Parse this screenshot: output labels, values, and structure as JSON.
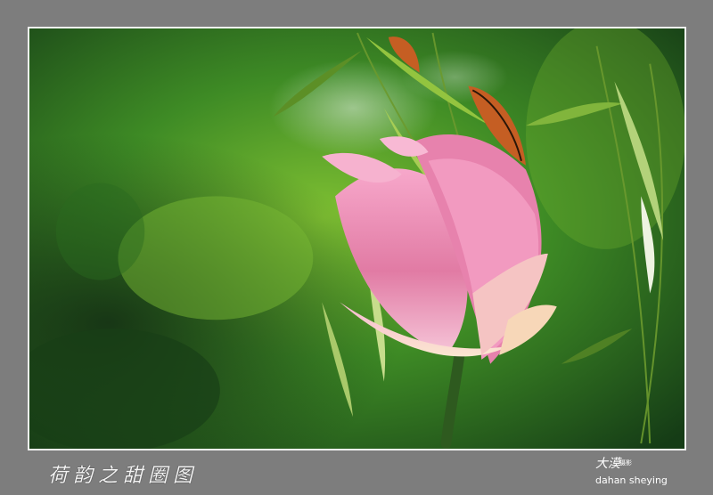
{
  "photo": {
    "subject": "pink-lotus-bud-with-willow-leaves",
    "palette": {
      "background": "#7d7d7d",
      "border": "#f2f2f2",
      "deep-green": "#163a17",
      "mid-green": "#3c8a25",
      "light-green": "#7dbf35",
      "petal-pink": "#ef8db5",
      "petal-light": "#ffd6e7",
      "butterfly": "#c55e23"
    }
  },
  "caption": {
    "title": "荷韵之甜圈图"
  },
  "signature": {
    "name": "大漠",
    "tag": "摄影",
    "latin": "dahan sheying"
  }
}
